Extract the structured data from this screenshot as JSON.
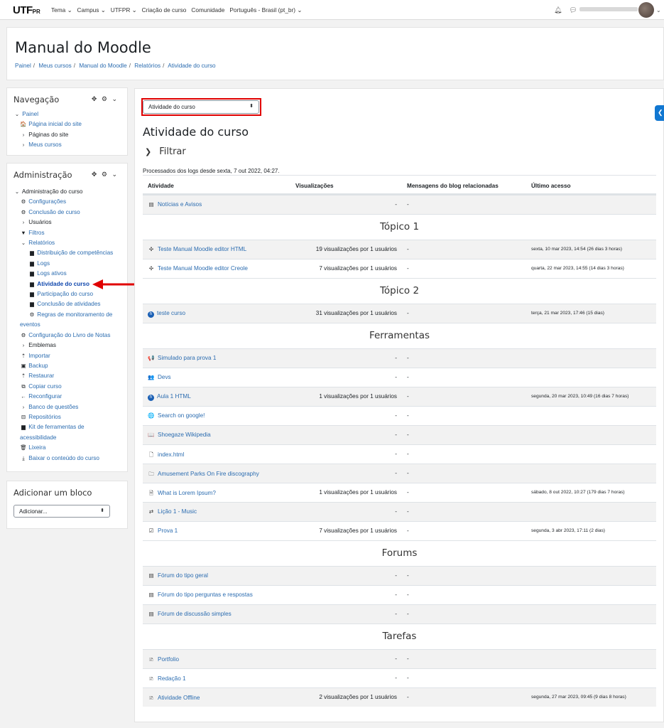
{
  "topbar": {
    "logo_main": "UTF",
    "logo_sub": "PR",
    "nav": [
      "Tema ⌄",
      "Campus ⌄",
      "UTFPR ⌄",
      "Criação de curso",
      "Comunidade",
      "Português - Brasil (pt_br) ⌄"
    ]
  },
  "header": {
    "title": "Manual do Moodle",
    "breadcrumb": [
      "Painel",
      "Meus cursos",
      "Manual do Moodle",
      "Relatórios",
      "Atividade do curso"
    ]
  },
  "nav_block": {
    "title": "Navegação",
    "items": [
      {
        "label": "Painel",
        "prefix": "⌄",
        "link": true
      },
      {
        "label": "Página inicial do site",
        "prefix": "🏠",
        "link": true
      },
      {
        "label": "Páginas do site",
        "prefix": "›",
        "link": false
      },
      {
        "label": "Meus cursos",
        "prefix": "›",
        "link": true
      }
    ]
  },
  "admin_block": {
    "title": "Administração",
    "items": [
      {
        "label": "Administração do curso",
        "prefix": "⌄",
        "link": false
      },
      {
        "label": "Configurações",
        "prefix": "⚙",
        "link": true
      },
      {
        "label": "Conclusão de curso",
        "prefix": "⚙",
        "link": true
      },
      {
        "label": "Usuários",
        "prefix": "›",
        "link": false
      },
      {
        "label": "Filtros",
        "prefix": "▼",
        "link": true
      },
      {
        "label": "Relatórios",
        "prefix": "⌄",
        "link": true
      },
      {
        "label": "Distribuição de competências",
        "prefix": "▆",
        "link": true
      },
      {
        "label": "Logs",
        "prefix": "▆",
        "link": true
      },
      {
        "label": "Logs ativos",
        "prefix": "▆",
        "link": true
      },
      {
        "label": "Atividade do curso",
        "prefix": "▆",
        "link": true
      },
      {
        "label": "Participação do curso",
        "prefix": "▆",
        "link": true
      },
      {
        "label": "Conclusão de atividades",
        "prefix": "▆",
        "link": true
      },
      {
        "label": "Regras de monitoramento de",
        "prefix": "⚙",
        "link": true
      },
      {
        "label": "eventos",
        "prefix": "",
        "link": true
      },
      {
        "label": "Configuração do Livro de Notas",
        "prefix": "⚙",
        "link": true
      },
      {
        "label": "Emblemas",
        "prefix": "›",
        "link": false
      },
      {
        "label": "Importar",
        "prefix": "⇡",
        "link": true
      },
      {
        "label": "Backup",
        "prefix": "▣",
        "link": true
      },
      {
        "label": "Restaurar",
        "prefix": "⇡",
        "link": true
      },
      {
        "label": "Copiar curso",
        "prefix": "⧉",
        "link": true
      },
      {
        "label": "Reconfigurar",
        "prefix": "←",
        "link": true
      },
      {
        "label": "Banco de questões",
        "prefix": "›",
        "link": true
      },
      {
        "label": "Repositórios",
        "prefix": "⊟",
        "link": true
      },
      {
        "label": "Kit de ferramentas de",
        "prefix": "▆",
        "link": true
      },
      {
        "label": "acessibilidade",
        "prefix": "",
        "link": true
      },
      {
        "label": "Lixeira",
        "prefix": "🗑",
        "link": true
      },
      {
        "label": "Baixar o conteúdo do curso",
        "prefix": "⤓",
        "link": true
      }
    ]
  },
  "add_block": {
    "title": "Adicionar um bloco",
    "select_value": "Adicionar..."
  },
  "main": {
    "report_select": "Atividade do curso",
    "title": "Atividade do curso",
    "filter_label": "Filtrar",
    "processed_text": "Processados dos logs desde sexta, 7 out 2022, 04:27.",
    "columns": [
      "Atividade",
      "Visualizações",
      "Mensagens do blog relacionadas",
      "Último acesso"
    ],
    "rows": [
      {
        "name": "Notícias e Avisos",
        "icon": "▤",
        "views": "-",
        "blog": "-",
        "last": ""
      },
      {
        "section": "Tópico 1"
      },
      {
        "name": "Teste Manual Moodle editor HTML",
        "icon": "✣",
        "views": "19 visualizações por 1 usuários",
        "blog": "-",
        "last": "sexta, 10 mar 2023, 14:54 (26 dias 3 horas)"
      },
      {
        "name": "Teste Manual Moodle editor Creole",
        "icon": "✣",
        "views": "7 visualizações por 1 usuários",
        "blog": "-",
        "last": "quarta, 22 mar 2023, 14:55 (14 dias 3 horas)"
      },
      {
        "section": "Tópico 2"
      },
      {
        "name": "teste curso",
        "icon": "h",
        "views": "31 visualizações por 1 usuários",
        "blog": "-",
        "last": "terça, 21 mar 2023, 17:46 (15 dias)"
      },
      {
        "section": "Ferramentas"
      },
      {
        "name": "Simulado para prova 1",
        "icon": "📢",
        "views": "-",
        "blog": "-",
        "last": ""
      },
      {
        "name": "Devs",
        "icon": "👥",
        "views": "-",
        "blog": "-",
        "last": ""
      },
      {
        "name": "Aula 1 HTML",
        "icon": "h",
        "views": "1 visualizações por 1 usuários",
        "blog": "-",
        "last": "segunda, 20 mar 2023, 10:49 (16 dias 7 horas)"
      },
      {
        "name": "Search on google!",
        "icon": "🌐",
        "views": "-",
        "blog": "-",
        "last": ""
      },
      {
        "name": "Shoegaze Wikipedia",
        "icon": "📖",
        "views": "-",
        "blog": "-",
        "last": ""
      },
      {
        "name": "index.html",
        "icon": "🗋",
        "views": "-",
        "blog": "-",
        "last": ""
      },
      {
        "name": "Amusement Parks On Fire discography",
        "icon": "🗀",
        "views": "-",
        "blog": "-",
        "last": ""
      },
      {
        "name": "What is Lorem Ipsum?",
        "icon": "🗎",
        "views": "1 visualizações por 1 usuários",
        "blog": "-",
        "last": "sábado, 8 out 2022, 10:27 (179 dias 7 horas)"
      },
      {
        "name": "Lição 1 - Music",
        "icon": "⇄",
        "views": "-",
        "blog": "-",
        "last": ""
      },
      {
        "name": "Prova 1",
        "icon": "☑",
        "views": "7 visualizações por 1 usuários",
        "blog": "-",
        "last": "segunda, 3 abr 2023, 17:11 (2 dias)"
      },
      {
        "section": "Forums"
      },
      {
        "name": "Fórum do tipo geral",
        "icon": "▤",
        "views": "-",
        "blog": "-",
        "last": ""
      },
      {
        "name": "Fórum do tipo perguntas e respostas",
        "icon": "▤",
        "views": "-",
        "blog": "-",
        "last": ""
      },
      {
        "name": "Fórum de discussão simples",
        "icon": "▤",
        "views": "-",
        "blog": "-",
        "last": ""
      },
      {
        "section": "Tarefas"
      },
      {
        "name": "Portfolio",
        "icon": "🗈",
        "views": "-",
        "blog": "-",
        "last": ""
      },
      {
        "name": "Redação 1",
        "icon": "🗈",
        "views": "-",
        "blog": "-",
        "last": ""
      },
      {
        "name": "Atividade Offline",
        "icon": "🗈",
        "views": "2 visualizações por 1 usuários",
        "blog": "-",
        "last": "segunda, 27 mar 2023, 09:45 (9 dias 8 horas)"
      }
    ]
  },
  "colors": {
    "link": "#2b6cb0",
    "highlight": "#e00000",
    "accent": "#1177d1"
  }
}
